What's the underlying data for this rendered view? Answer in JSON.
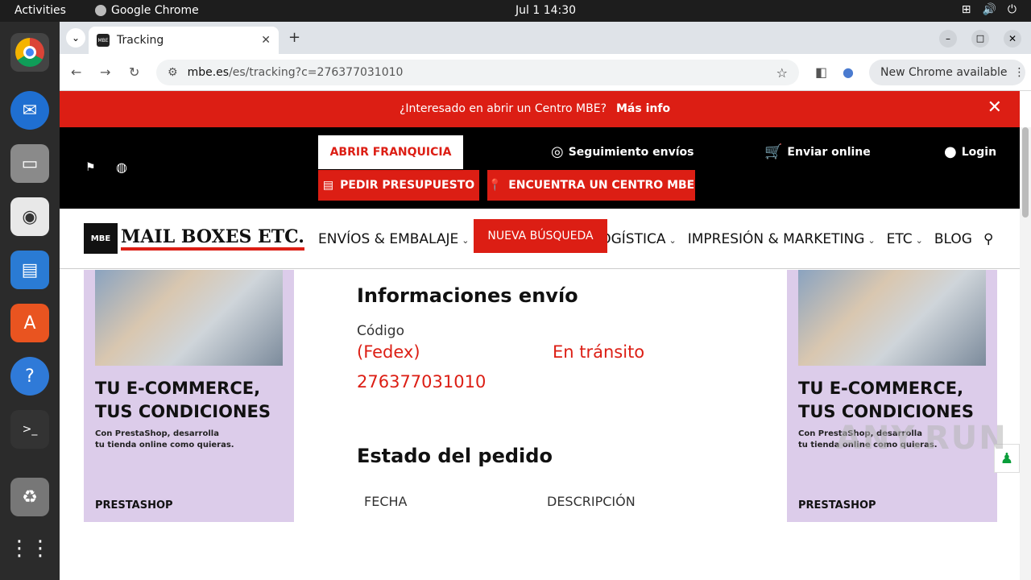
{
  "os": {
    "activities": "Activities",
    "app_name": "Google Chrome",
    "clock": "Jul 1  14:30"
  },
  "browser": {
    "tab_title": "Tracking",
    "url_domain": "mbe.es",
    "url_path": "/es/tracking?c=276377031010",
    "new_chrome_label": "New Chrome available"
  },
  "promo": {
    "question": "¿Interesado en abrir un Centro MBE?",
    "more_info": "Más info"
  },
  "header": {
    "abrir_franquicia": "ABRIR FRANQUICIA",
    "pedir_presupuesto": "PEDIR PRESUPUESTO",
    "encuentra_centro": "ENCUENTRA UN CENTRO MBE",
    "seguimiento": "Seguimiento envíos",
    "enviar_online": "Enviar online",
    "login": "Login"
  },
  "nav": {
    "logo_badge": "MBE",
    "logo_text": "MAIL BOXES ETC.",
    "items": [
      "ENVÍOS & EMBALAJE",
      "E-COMMERCE & LOGÍSTICA",
      "IMPRESIÓN & MARKETING",
      "ETC",
      "BLOG"
    ]
  },
  "ad": {
    "headline_1": "TU E-COMMERCE,",
    "headline_2": "TUS CONDICIONES",
    "sub_1": "Con PrestaShop, desarrolla",
    "sub_2": "tu tienda online como quieras.",
    "brand": "PRESTASHOP"
  },
  "tracking": {
    "new_search": "NUEVA BÚSQUEDA",
    "info_title": "Informaciones envío",
    "code_label": "Código",
    "carrier": "(Fedex)",
    "status": "En tránsito",
    "code": "276377031010",
    "order_title": "Estado del pedido",
    "col_date": "FECHA",
    "col_desc": "DESCRIPCIÓN"
  },
  "watermark": "ANY.RUN",
  "colors": {
    "brand_red": "#dc1e14",
    "black_bar": "#000000",
    "ad_bg": "#dcccea"
  }
}
